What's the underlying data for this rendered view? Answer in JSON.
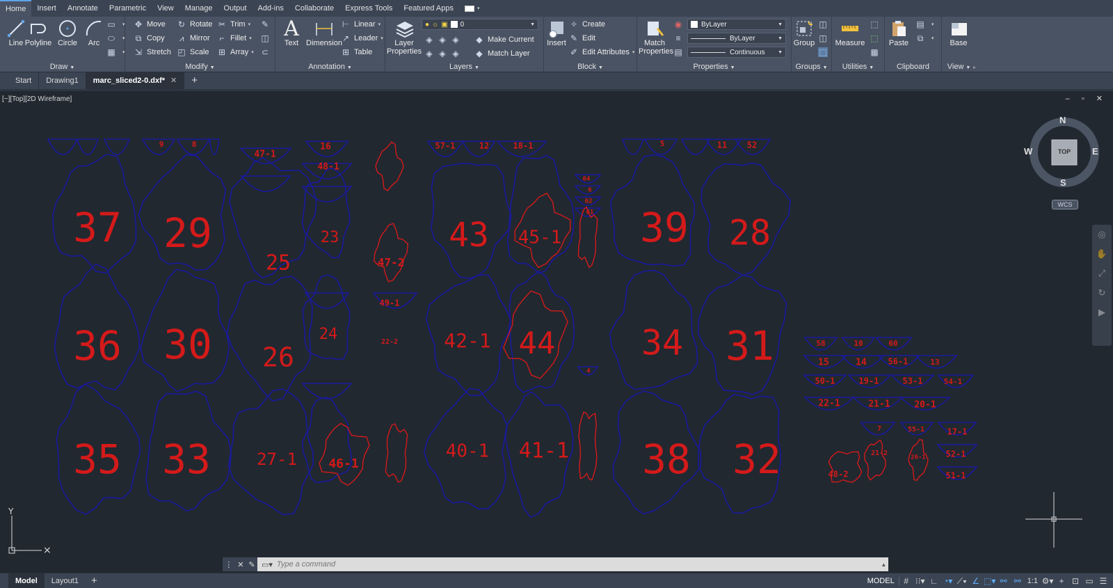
{
  "ribbon_tabs": [
    "Home",
    "Insert",
    "Annotate",
    "Parametric",
    "View",
    "Manage",
    "Output",
    "Add-ins",
    "Collaborate",
    "Express Tools",
    "Featured Apps"
  ],
  "active_tab": "Home",
  "panels": {
    "draw": {
      "title": "Draw",
      "line": "Line",
      "polyline": "Polyline",
      "circle": "Circle",
      "arc": "Arc"
    },
    "modify": {
      "title": "Modify",
      "move": "Move",
      "rotate": "Rotate",
      "trim": "Trim",
      "copy": "Copy",
      "mirror": "Mirror",
      "fillet": "Fillet",
      "stretch": "Stretch",
      "scale": "Scale",
      "array": "Array"
    },
    "annotation": {
      "title": "Annotation",
      "text": "Text",
      "dimension": "Dimension",
      "linear": "Linear",
      "leader": "Leader",
      "table": "Table"
    },
    "layers": {
      "title": "Layers",
      "layer_properties": "Layer Properties",
      "current_layer": "0",
      "make_current": "Make Current",
      "match_layer": "Match Layer"
    },
    "block": {
      "title": "Block",
      "insert": "Insert",
      "create": "Create",
      "edit": "Edit",
      "edit_attributes": "Edit Attributes"
    },
    "properties": {
      "title": "Properties",
      "match_properties": "Match Properties",
      "color": "ByLayer",
      "lineweight": "ByLayer",
      "linetype": "Continuous"
    },
    "groups": {
      "title": "Groups",
      "group": "Group"
    },
    "utilities": {
      "title": "Utilities",
      "measure": "Measure"
    },
    "clipboard": {
      "title": "Clipboard",
      "paste": "Paste"
    },
    "view": {
      "title": "View",
      "base": "Base"
    }
  },
  "file_tabs": [
    "Start",
    "Drawing1",
    "marc_sliced2-0.dxf*"
  ],
  "active_file": "marc_sliced2-0.dxf*",
  "viewport_label": "[−][Top][2D Wireframe]",
  "viewcube": {
    "face": "TOP",
    "north": "N",
    "south": "S",
    "east": "E",
    "west": "W",
    "wcs": "WCS"
  },
  "drawing_labels": [
    {
      "id": "37",
      "size": 58
    },
    {
      "id": "29",
      "size": 58
    },
    {
      "id": "36",
      "size": 58
    },
    {
      "id": "30",
      "size": 58
    },
    {
      "id": "35",
      "size": 58
    },
    {
      "id": "33",
      "size": 58
    },
    {
      "id": "25",
      "size": 30
    },
    {
      "id": "26",
      "size": 38
    },
    {
      "id": "27-1",
      "size": 24
    },
    {
      "id": "23",
      "size": 22
    },
    {
      "id": "24",
      "size": 22
    },
    {
      "id": "46-1",
      "size": 18
    },
    {
      "id": "47-2",
      "size": 16
    },
    {
      "id": "43",
      "size": 48
    },
    {
      "id": "45-1",
      "size": 26
    },
    {
      "id": "42-1",
      "size": 28
    },
    {
      "id": "44",
      "size": 44
    },
    {
      "id": "40-1",
      "size": 26
    },
    {
      "id": "41-1",
      "size": 30
    },
    {
      "id": "39",
      "size": 58
    },
    {
      "id": "28",
      "size": 50
    },
    {
      "id": "34",
      "size": 50
    },
    {
      "id": "31",
      "size": 58
    },
    {
      "id": "38",
      "size": 58
    },
    {
      "id": "32",
      "size": 58
    },
    {
      "id": "47-1",
      "size": 13
    },
    {
      "id": "16",
      "size": 13
    },
    {
      "id": "48-1",
      "size": 13
    },
    {
      "id": "49-1",
      "size": 12
    },
    {
      "id": "22-2",
      "size": 10
    },
    {
      "id": "57-1",
      "size": 12
    },
    {
      "id": "12",
      "size": 12
    },
    {
      "id": "18-1",
      "size": 12
    },
    {
      "id": "9",
      "size": 11
    },
    {
      "id": "8",
      "size": 11
    },
    {
      "id": "5",
      "size": 11
    },
    {
      "id": "11",
      "size": 12
    },
    {
      "id": "52",
      "size": 12
    },
    {
      "id": "58",
      "size": 11
    },
    {
      "id": "10",
      "size": 11
    },
    {
      "id": "60",
      "size": 11
    },
    {
      "id": "15",
      "size": 13
    },
    {
      "id": "14",
      "size": 13
    },
    {
      "id": "56-1",
      "size": 12
    },
    {
      "id": "13",
      "size": 11
    },
    {
      "id": "50-1",
      "size": 12
    },
    {
      "id": "19-1",
      "size": 12
    },
    {
      "id": "53-1",
      "size": 12
    },
    {
      "id": "54-1",
      "size": 11
    },
    {
      "id": "22-1",
      "size": 13
    },
    {
      "id": "21-1",
      "size": 13
    },
    {
      "id": "20-1",
      "size": 13
    },
    {
      "id": "7",
      "size": 10
    },
    {
      "id": "55-1",
      "size": 10
    },
    {
      "id": "17-1",
      "size": 12
    },
    {
      "id": "21-2",
      "size": 10
    },
    {
      "id": "26-1",
      "size": 9
    },
    {
      "id": "52-1",
      "size": 12
    },
    {
      "id": "51-1",
      "size": 12
    },
    {
      "id": "48-2",
      "size": 12
    },
    {
      "id": "64",
      "size": 9
    },
    {
      "id": "6",
      "size": 9
    },
    {
      "id": "62",
      "size": 9
    },
    {
      "id": "61",
      "size": 9
    },
    {
      "id": "4",
      "size": 9
    }
  ],
  "command_placeholder": "Type a command",
  "layout_tabs": [
    "Model",
    "Layout1"
  ],
  "active_layout": "Model",
  "status": {
    "space": "MODEL",
    "scale": "1:1"
  },
  "colors": {
    "outline": "#1a1a9c",
    "label": "#d41a1a",
    "background": "#212830",
    "ribbon": "#4a5363"
  }
}
